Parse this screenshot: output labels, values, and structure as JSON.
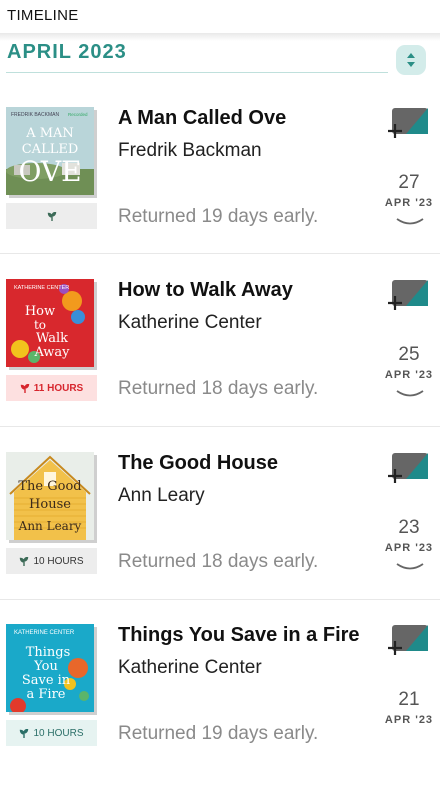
{
  "header": {
    "title": "TIMELINE"
  },
  "month": {
    "label": "APRIL 2023"
  },
  "entries": [
    {
      "title": "A Man Called Ove",
      "author": "Fredrik Backman",
      "status": "Returned 19 days early.",
      "badge": "",
      "day": "27",
      "month_year": "APR '23",
      "cover": {
        "top": "FREDRIK BACKMAN",
        "corner": "Recorded",
        "lines": [
          "A MAN",
          "CALLED",
          "OVE"
        ]
      }
    },
    {
      "title": "How to Walk Away",
      "author": "Katherine Center",
      "status": "Returned 18 days early.",
      "badge": "11 HOURS",
      "day": "25",
      "month_year": "APR '23",
      "cover": {
        "top": "KATHERINE CENTER",
        "lines": [
          "How",
          "to",
          "Walk",
          "Away"
        ]
      }
    },
    {
      "title": "The Good House",
      "author": "Ann Leary",
      "status": "Returned 18 days early.",
      "badge": "10 HOURS",
      "day": "23",
      "month_year": "APR '23",
      "cover": {
        "lines": [
          "The Good",
          "House",
          "Ann Leary"
        ]
      }
    },
    {
      "title": "Things You Save in a Fire",
      "author": "Katherine Center",
      "status": "Returned 19 days early.",
      "badge": "10 HOURS",
      "day": "21",
      "month_year": "APR '23",
      "cover": {
        "top": "KATHERINE CENTER",
        "lines": [
          "Things",
          "You",
          "Save in",
          "a Fire"
        ]
      }
    }
  ],
  "colors": {
    "accent": "#2b8f86",
    "badge_red": "#d7262e",
    "muted": "#8a8a8a"
  }
}
